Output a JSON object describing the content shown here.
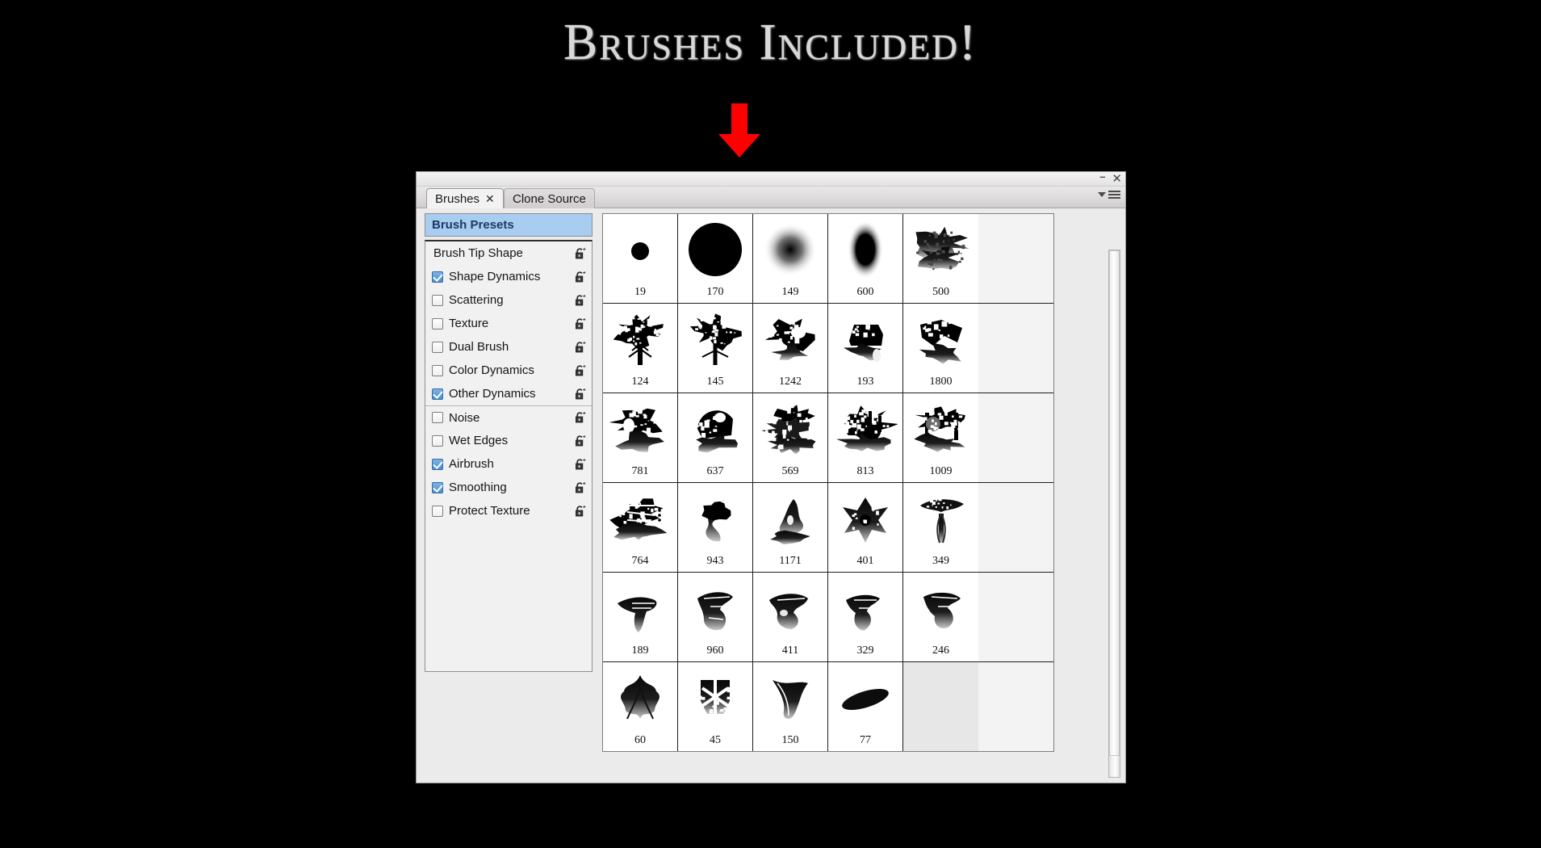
{
  "banner": {
    "title": "Brushes Included!",
    "arrow_icon": "red-down-arrow",
    "arrow_color": "#ff0000"
  },
  "panel": {
    "window_buttons": {
      "minimize": "–",
      "close": "✕"
    },
    "menu_icon": "panel-menu-icon",
    "tabs": [
      {
        "label": "Brushes",
        "active": true,
        "closable": true,
        "close_glyph": "✕"
      },
      {
        "label": "Clone Source",
        "active": false,
        "closable": false,
        "close_glyph": ""
      }
    ],
    "sidebar": {
      "header": {
        "label": "Brush Presets",
        "selected": true
      },
      "items": [
        {
          "label": "Brush Tip Shape",
          "type": "plain",
          "checked": false,
          "lock": true,
          "separator": false
        },
        {
          "label": "Shape Dynamics",
          "type": "checkbox",
          "checked": true,
          "lock": true,
          "separator": false
        },
        {
          "label": "Scattering",
          "type": "checkbox",
          "checked": false,
          "lock": true,
          "separator": false
        },
        {
          "label": "Texture",
          "type": "checkbox",
          "checked": false,
          "lock": true,
          "separator": false
        },
        {
          "label": "Dual Brush",
          "type": "checkbox",
          "checked": false,
          "lock": true,
          "separator": false
        },
        {
          "label": "Color Dynamics",
          "type": "checkbox",
          "checked": false,
          "lock": true,
          "separator": false
        },
        {
          "label": "Other Dynamics",
          "type": "checkbox",
          "checked": true,
          "lock": true,
          "separator": false
        },
        {
          "label": "Noise",
          "type": "checkbox",
          "checked": false,
          "lock": true,
          "separator": true
        },
        {
          "label": "Wet Edges",
          "type": "checkbox",
          "checked": false,
          "lock": true,
          "separator": false
        },
        {
          "label": "Airbrush",
          "type": "checkbox",
          "checked": true,
          "lock": true,
          "separator": false
        },
        {
          "label": "Smoothing",
          "type": "checkbox",
          "checked": true,
          "lock": true,
          "separator": false
        },
        {
          "label": "Protect Texture",
          "type": "checkbox",
          "checked": false,
          "lock": true,
          "separator": false
        }
      ],
      "lock_icon": "padlock-icon"
    },
    "brush_grid": {
      "rows": [
        [
          {
            "size": "19",
            "shape": "dot-small"
          },
          {
            "size": "170",
            "shape": "dot-large"
          },
          {
            "size": "149",
            "shape": "soft-round"
          },
          {
            "size": "600",
            "shape": "soft-oval-vertical"
          },
          {
            "size": "500",
            "shape": "cloud-splatter"
          }
        ],
        [
          {
            "size": "124",
            "shape": "tree-broad"
          },
          {
            "size": "145",
            "shape": "tree-conifer"
          },
          {
            "size": "1242",
            "shape": "wreck-hull"
          },
          {
            "size": "193",
            "shape": "ship-silhouette"
          },
          {
            "size": "1800",
            "shape": "debris-spikes"
          }
        ],
        [
          {
            "size": "781",
            "shape": "machine-block"
          },
          {
            "size": "637",
            "shape": "wheel-fragment"
          },
          {
            "size": "569",
            "shape": "grunge-smear"
          },
          {
            "size": "813",
            "shape": "factory-scatter"
          },
          {
            "size": "1009",
            "shape": "ruins-structure"
          }
        ],
        [
          {
            "size": "764",
            "shape": "circuit-board"
          },
          {
            "size": "943",
            "shape": "smoke-swirl"
          },
          {
            "size": "1171",
            "shape": "figure-smear"
          },
          {
            "size": "401",
            "shape": "star-burst"
          },
          {
            "size": "349",
            "shape": "tree-wispy"
          }
        ],
        [
          {
            "size": "189",
            "shape": "ink-streak-a"
          },
          {
            "size": "960",
            "shape": "ink-streak-b"
          },
          {
            "size": "411",
            "shape": "ink-streak-c"
          },
          {
            "size": "329",
            "shape": "ink-streak-d"
          },
          {
            "size": "246",
            "shape": "ink-streak-e"
          }
        ],
        [
          {
            "size": "60",
            "shape": "splash-burst"
          },
          {
            "size": "45",
            "shape": "grunge-cross"
          },
          {
            "size": "150",
            "shape": "flame-wisp"
          },
          {
            "size": "77",
            "shape": "ellipse-angled"
          },
          {
            "size": "",
            "shape": "empty"
          }
        ]
      ]
    },
    "scrollbar": {
      "name": "vertical-scrollbar"
    }
  },
  "colors": {
    "background": "#000000",
    "panel_bg": "#ecebeb",
    "selection_blue": "#a8cdf0",
    "accent_red": "#ff0000",
    "title_text": "#d8d8d8"
  }
}
